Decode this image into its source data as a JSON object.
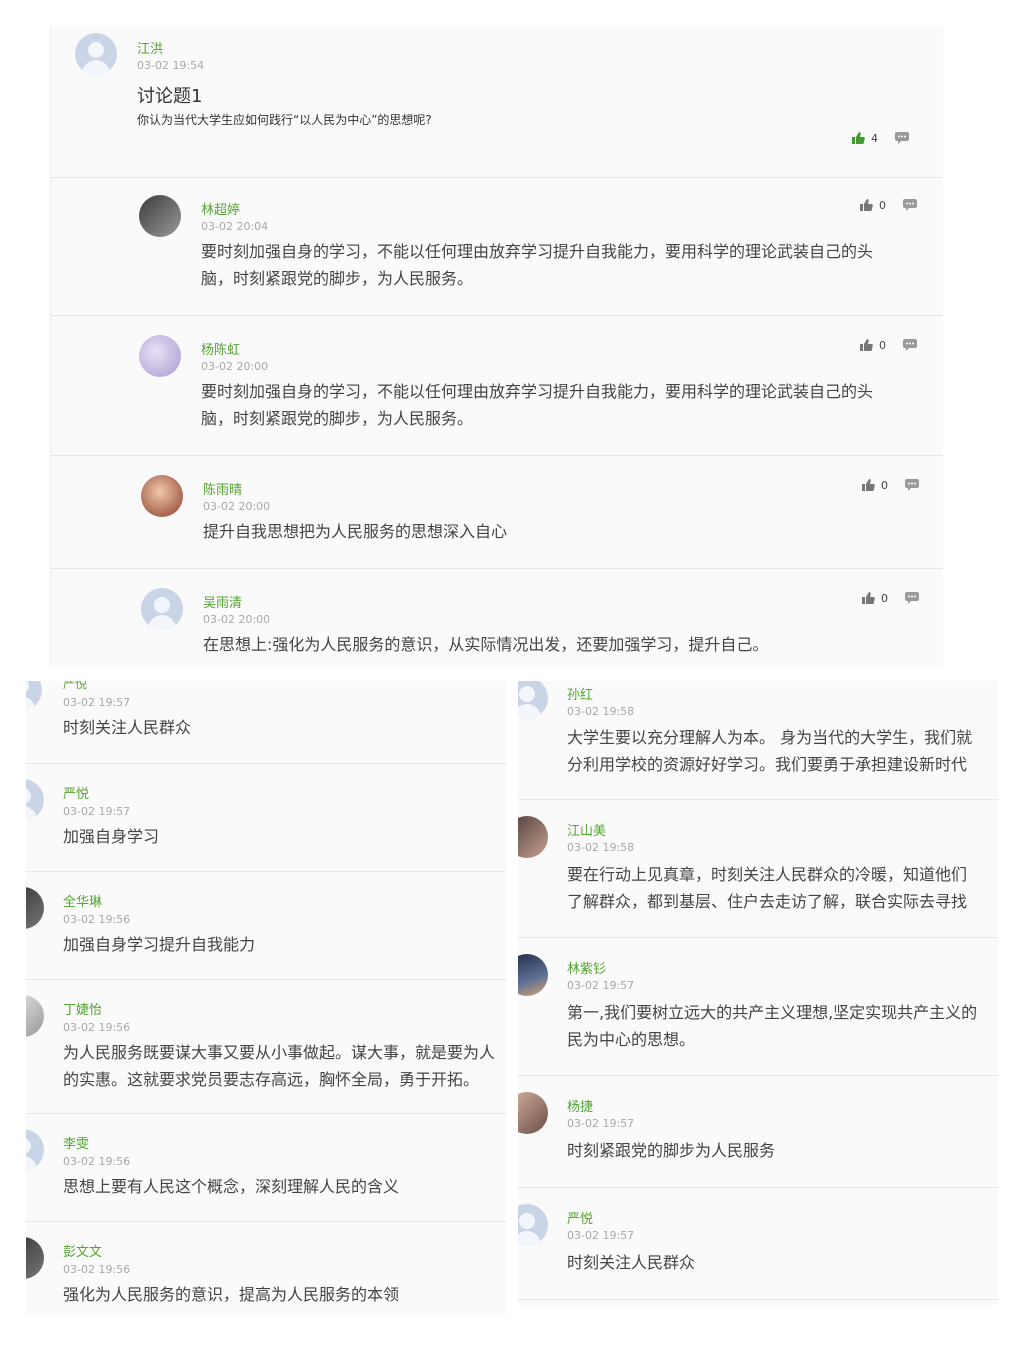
{
  "post": {
    "author": "江洪",
    "time": "03-02 19:54",
    "title": "讨论题1",
    "description": "你认为当代大学生应如何践行“以人民为中心”的思想呢?",
    "likes": "4"
  },
  "replies": [
    {
      "author": "林超婷",
      "time": "03-02 20:04",
      "likes": "0",
      "line1": "要时刻加强自身的学习，不能以任何理由放弃学习提升自我能力，要用科学的理论武装自己的头",
      "line2": "脑，时刻紧跟党的脚步，为人民服务。"
    },
    {
      "author": "杨陈虹",
      "time": "03-02 20:00",
      "likes": "0",
      "line1": "要时刻加强自身的学习，不能以任何理由放弃学习提升自我能力，要用科学的理论武装自己的头",
      "line2": "脑，时刻紧跟党的脚步，为人民服务。"
    },
    {
      "author": "陈雨晴",
      "time": "03-02 20:00",
      "likes": "0",
      "line1": "提升自我思想把为人民服务的思想深入自心",
      "line2": ""
    },
    {
      "author": "吴雨清",
      "time": "03-02 20:00",
      "likes": "0",
      "line1": "在思想上:强化为人民服务的意识，从实际情况出发，还要加强学习，提升自己。",
      "line2": ""
    }
  ],
  "left_list": [
    {
      "author": "严悦",
      "time": "03-02 19:57",
      "line1": "时刻关注人民群众",
      "line2": ""
    },
    {
      "author": "严悦",
      "time": "03-02 19:57",
      "line1": "加强自身学习",
      "line2": ""
    },
    {
      "author": "全华琳",
      "time": "03-02 19:56",
      "line1": "加强自身学习提升自我能力",
      "line2": ""
    },
    {
      "author": "丁婕怡",
      "time": "03-02 19:56",
      "line1": "为人民服务既要谋大事又要从小事做起。谋大事，就是要为人",
      "line2": "的实惠。这就要求党员要志存高远，胸怀全局，勇于开拓。"
    },
    {
      "author": "李雯",
      "time": "03-02 19:56",
      "line1": "思想上要有人民这个概念，深刻理解人民的含义",
      "line2": ""
    },
    {
      "author": "彭文文",
      "time": "03-02 19:56",
      "line1": "强化为人民服务的意识，提高为人民服务的本领",
      "line2": ""
    }
  ],
  "right_list": [
    {
      "author": "孙红",
      "time": "03-02 19:58",
      "line1": "大学生要以充分理解人为本。 身为当代的大学生，我们就",
      "line2": "分利用学校的资源好好学习。我们要勇于承担建设新时代"
    },
    {
      "author": "江山美",
      "time": "03-02 19:58",
      "line1": "要在行动上见真章，时刻关注人民群众的冷暖，知道他们",
      "line2": "了解群众，都到基层、住户去走访了解，联合实际去寻找"
    },
    {
      "author": "林紫钐",
      "time": "03-02 19:57",
      "line1": "第一,我们要树立远大的共产主义理想,坚定实现共产主义的",
      "line2": "民为中心的思想。"
    },
    {
      "author": "杨捷",
      "time": "03-02 19:57",
      "line1": "时刻紧跟党的脚步为人民服务",
      "line2": ""
    },
    {
      "author": "严悦",
      "time": "03-02 19:57",
      "line1": "时刻关注人民群众",
      "line2": ""
    }
  ],
  "icons": {
    "like": "thumbs-up-icon",
    "comment": "comment-icon"
  },
  "colors": {
    "name_green": "#55a532",
    "like_green": "#3f9b2c",
    "text": "#444444",
    "muted": "#a8a8a8"
  }
}
